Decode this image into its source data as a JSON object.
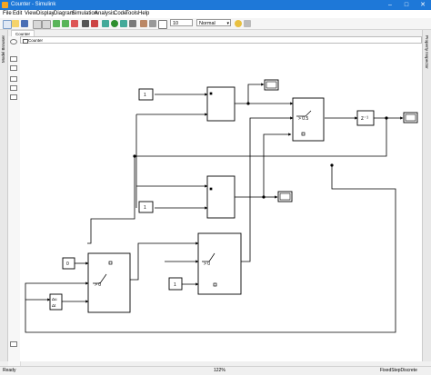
{
  "window": {
    "title": "Counter - Simulink"
  },
  "menu": [
    "File",
    "Edit",
    "View",
    "Display",
    "Diagram",
    "Simulation",
    "Analysis",
    "Code",
    "Tools",
    "Help"
  ],
  "toolbar": {
    "stop_time": "10",
    "sim_mode": "Normal"
  },
  "panels": {
    "left": "Model Browser",
    "right": "Property Inspector"
  },
  "editor": {
    "tab": "Counter",
    "breadcrumb": "Counter"
  },
  "blocks": {
    "const_top": "1",
    "const_mid": "1",
    "const_init": "0",
    "const_bottom": "1",
    "switch_top_threshold": "> 0.5",
    "switch_left_threshold": "> 0",
    "switch_mid_threshold": "> 0",
    "unit_delay": "z⁻¹",
    "derivative_top": "Δu",
    "derivative_bottom": "Δt"
  },
  "status": {
    "left": "Ready",
    "zoom": "122%",
    "solver": "FixedStepDiscrete"
  }
}
